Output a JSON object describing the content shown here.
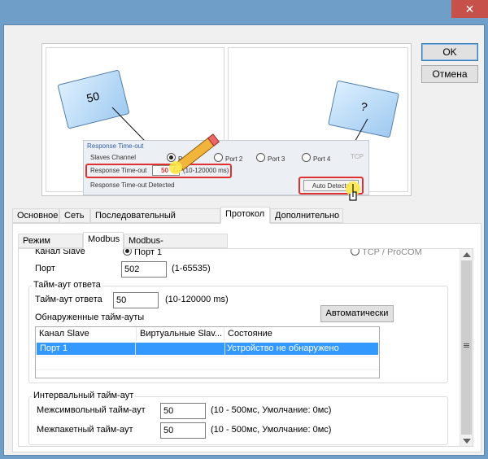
{
  "window": {
    "close_glyph": "✕"
  },
  "buttons": {
    "ok": "OK",
    "cancel": "Отмена"
  },
  "illustration": {
    "book_left_value": "50",
    "book_right_value": "?",
    "form_title": "Response Time-out",
    "slaves_channel_label": "Slaves Channel",
    "port_options": [
      "Port",
      "Port 2",
      "Port 3",
      "Port 4",
      "TCP"
    ],
    "timeout_label": "Response Time-out",
    "timeout_value": "50",
    "timeout_range": "(10-120000 ms)",
    "detected_label": "Response Time-out Detected",
    "auto_detect_button": "Auto Detecte"
  },
  "main_tabs": [
    "Основное",
    "Сеть",
    "Последовательный интерфейс",
    "Протокол",
    "Дополнительно"
  ],
  "main_tab_active": "Протокол",
  "sub_tabs": [
    "Режим работы",
    "Modbus",
    "Modbus-маршрутизация"
  ],
  "sub_tab_active": "Modbus",
  "slave_channel": {
    "label": "Канал Slave",
    "option_port": "Порт 1",
    "option_tcp": "TCP / ProCOM"
  },
  "port": {
    "label": "Порт",
    "value": "502",
    "range": "(1-65535)"
  },
  "response_timeout": {
    "group_title": "Тайм-аут ответа",
    "label": "Тайм-аут ответа",
    "value": "50",
    "range": "(10-120000 ms)",
    "auto_button": "Автоматически",
    "detected_label": "Обнаруженные тайм-ауты",
    "columns": [
      "Канал Slave",
      "Виртуальные Slav...",
      "Состояние"
    ],
    "rows": [
      {
        "channel": "Порт 1",
        "virtual": "",
        "status": "Устройство не обнаружено"
      }
    ]
  },
  "interval_timeout": {
    "group_title": "Интервальный тайм-аут",
    "inter_char_label": "Межсимвольный тайм-аут",
    "inter_char_value": "50",
    "inter_char_range": "(10 - 500мс, Умолчание: 0мс)",
    "inter_frame_label": "Межпакетный тайм-аут",
    "inter_frame_value": "50",
    "inter_frame_range": "(10 - 500мс, Умолчание: 0мс)"
  },
  "colors": {
    "title_bar": "#6f9fc9",
    "close_button": "#c7504a",
    "selection": "#3399ff",
    "highlight_red": "#e03030"
  }
}
